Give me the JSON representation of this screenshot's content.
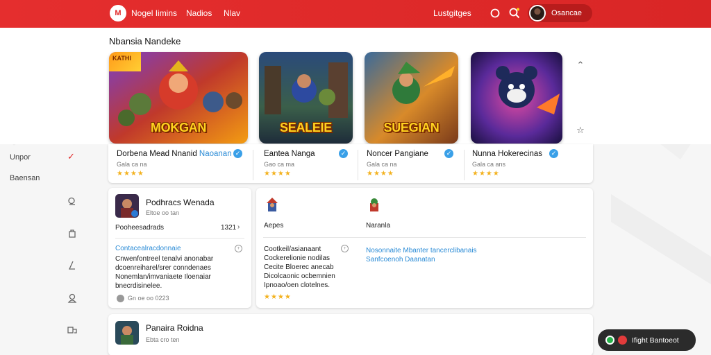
{
  "header": {
    "logo_text": "M",
    "nav": [
      "Nogel Iimins",
      "Nadios",
      "Nlav"
    ],
    "right_link": "Lustgitges",
    "user_name": "Osancae"
  },
  "section_title": "Nbansia Nandeke",
  "games": [
    {
      "art_title": "MOKGAN",
      "corner_badge": "KATHI",
      "name": "Dorbena Mead Nnanid",
      "name_highlight": "Naoanan",
      "sub": "Gala ca na",
      "stars": "★★★★"
    },
    {
      "art_title": "SEALEIE",
      "name": "Eantea Nanga",
      "sub": "Gao ca ma",
      "stars": "★★★★"
    },
    {
      "art_title": "SUEGIAN",
      "name": "Noncer Pangiane",
      "sub": "Gala ca na",
      "stars": "★★★★"
    },
    {
      "art_title": "",
      "name": "Nunna Hokerecinas",
      "sub": "Gala ca ans",
      "stars": "★★★★"
    }
  ],
  "sidebar": {
    "item1": "Unpor",
    "item2": "Baensan",
    "icons": [
      "check-icon",
      "search-icon",
      "puzzle-icon",
      "bolt-icon",
      "user-icon",
      "link-icon"
    ]
  },
  "panel_left": {
    "title": "Podhracs Wenada",
    "sub": "Eltoe oo tan",
    "row_label": "Pooheesadrads",
    "row_value": "1321",
    "link": "Contacealracdonnaie",
    "body": "Cnwenfontreel tenalvi anonabar dcoenreiharel/srer conndenaes Nonemlan/imvaniaete Iloenaiar bnecrdisinelee.",
    "footer": "Gn oe oo 0223"
  },
  "panel_mid": {
    "label": "Aepes",
    "link_head": "Cootkeil/asianaant",
    "body": "Cockerelionie nodilas Cecite Bloerec anecab Dicolcaonic ocbemnien Ipnoao/oen clotelnes.",
    "stars": "★★★★"
  },
  "panel_right": {
    "label": "Naranla",
    "link_text": "Nosonnaite Mbanter tancerclibanais Sanfcoenoh Daanatan"
  },
  "panel_bottom": {
    "title": "Panaira Roidna",
    "sub": "Ebta cro ten"
  },
  "toast": {
    "text": "Ifight Bantoeot"
  },
  "colors": {
    "accent": "#e12a2a",
    "link": "#2a8bd6",
    "star": "#f3b21f"
  }
}
